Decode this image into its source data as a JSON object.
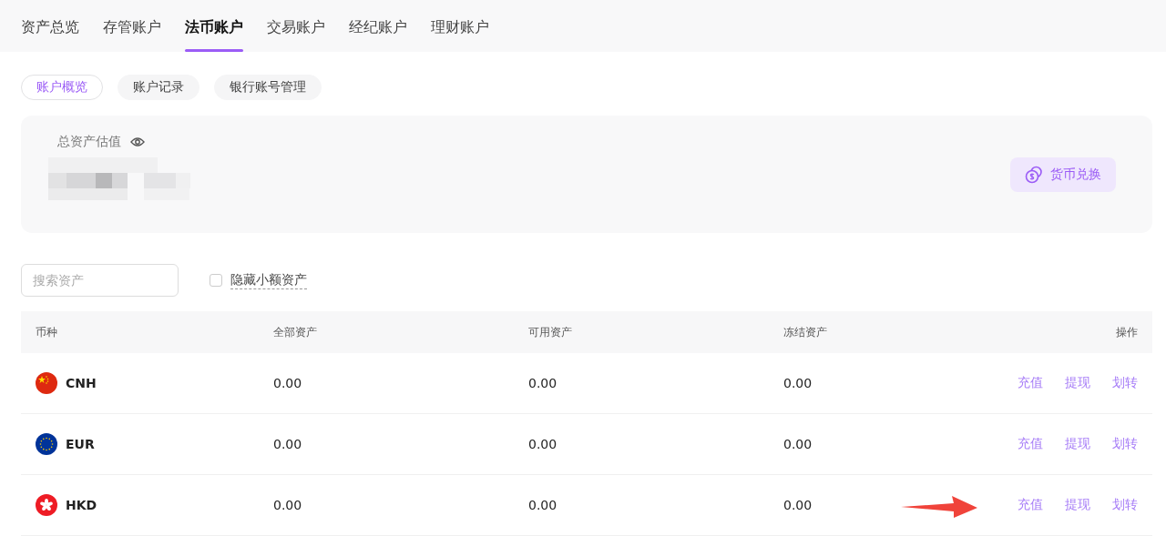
{
  "tabs": [
    {
      "label": "资产总览",
      "selected": false
    },
    {
      "label": "存管账户",
      "selected": false
    },
    {
      "label": "法币账户",
      "selected": true
    },
    {
      "label": "交易账户",
      "selected": false
    },
    {
      "label": "经纪账户",
      "selected": false
    },
    {
      "label": "理财账户",
      "selected": false
    }
  ],
  "subtabs": [
    {
      "label": "账户概览",
      "selected": true
    },
    {
      "label": "账户记录",
      "selected": false
    },
    {
      "label": "银行账号管理",
      "selected": false
    }
  ],
  "summary": {
    "label": "总资产估值",
    "button": "货币兑换"
  },
  "search": {
    "placeholder": "搜索资产"
  },
  "hide_small": {
    "label": "隐藏小额资产",
    "checked": false
  },
  "table": {
    "columns": [
      "币种",
      "全部资产",
      "可用资产",
      "冻结资产",
      "操作"
    ],
    "rows": [
      {
        "kind": "cn",
        "currency": "CNH",
        "total": "0.00",
        "available": "0.00",
        "frozen": "0.00",
        "actions": [
          "充值",
          "提现",
          "划转"
        ],
        "arrow": false
      },
      {
        "kind": "eu",
        "currency": "EUR",
        "total": "0.00",
        "available": "0.00",
        "frozen": "0.00",
        "actions": [
          "充值",
          "提现",
          "划转"
        ],
        "arrow": false
      },
      {
        "kind": "hk",
        "currency": "HKD",
        "total": "0.00",
        "available": "0.00",
        "frozen": "0.00",
        "actions": [
          "充值",
          "提现",
          "划转"
        ],
        "arrow": true
      }
    ]
  }
}
